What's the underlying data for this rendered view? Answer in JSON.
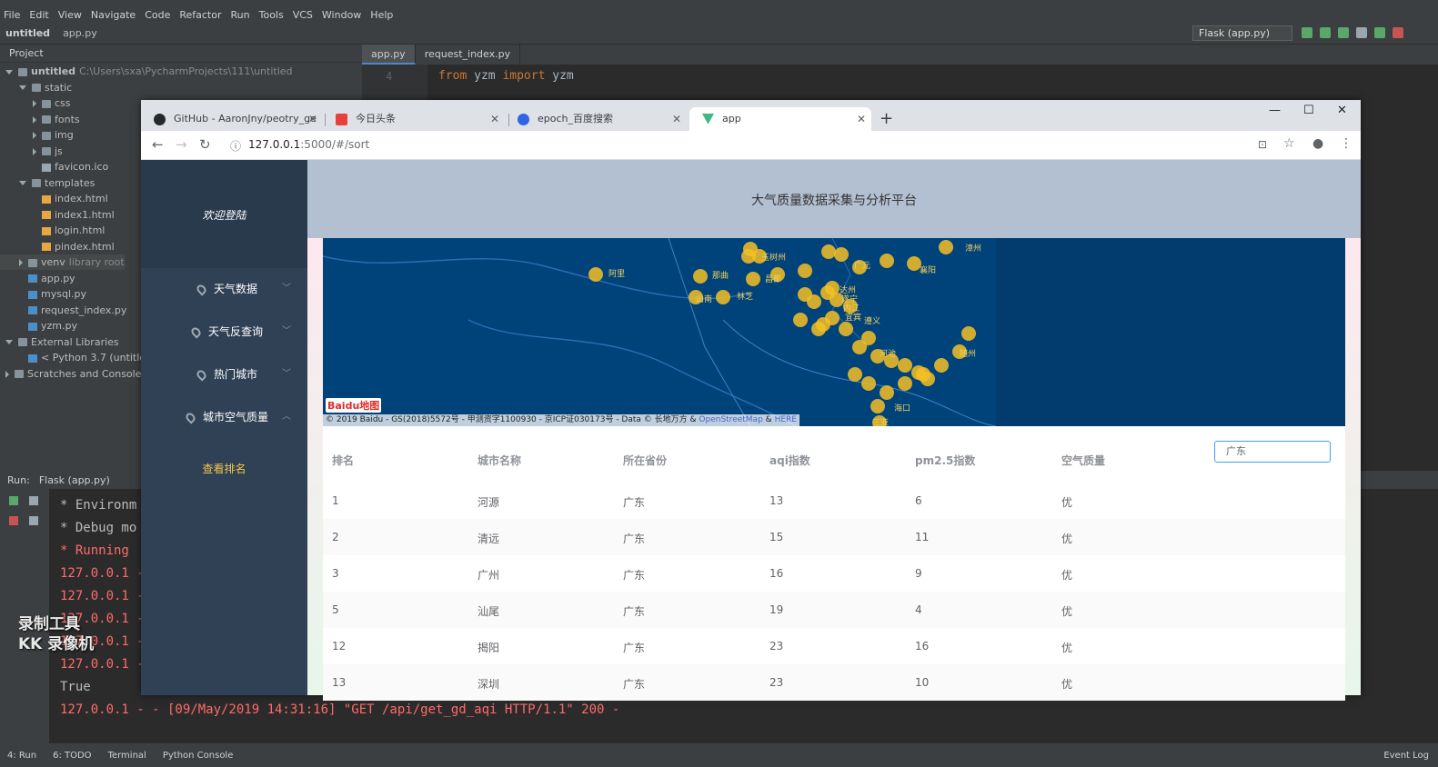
{
  "ide": {
    "menu": [
      "File",
      "Edit",
      "View",
      "Navigate",
      "Code",
      "Refactor",
      "Run",
      "Tools",
      "VCS",
      "Window",
      "Help"
    ],
    "breadcrumb": [
      "untitled",
      "app.py"
    ],
    "run_config": "Flask (app.py)",
    "project_header": "Project",
    "tree": [
      {
        "label": "untitled",
        "extra": "C:\\Users\\sxa\\PycharmProjects\\111\\untitled",
        "kind": "folder",
        "depth": 0,
        "open": true
      },
      {
        "label": "static",
        "kind": "folder",
        "depth": 1,
        "open": true
      },
      {
        "label": "css",
        "kind": "folder",
        "depth": 2,
        "open": false
      },
      {
        "label": "fonts",
        "kind": "folder",
        "depth": 2,
        "open": false
      },
      {
        "label": "img",
        "kind": "folder",
        "depth": 2,
        "open": false
      },
      {
        "label": "js",
        "kind": "folder",
        "depth": 2,
        "open": false
      },
      {
        "label": "favicon.ico",
        "kind": "ico",
        "depth": 2
      },
      {
        "label": "templates",
        "kind": "folder",
        "depth": 1,
        "open": true
      },
      {
        "label": "index.html",
        "kind": "html",
        "depth": 2
      },
      {
        "label": "index1.html",
        "kind": "html",
        "depth": 2
      },
      {
        "label": "login.html",
        "kind": "html",
        "depth": 2
      },
      {
        "label": "pindex.html",
        "kind": "html",
        "depth": 2
      },
      {
        "label": "venv",
        "extra": "library root",
        "kind": "folder",
        "depth": 1,
        "open": false
      },
      {
        "label": "app.py",
        "kind": "py",
        "depth": 1
      },
      {
        "label": "mysql.py",
        "kind": "py",
        "depth": 1
      },
      {
        "label": "request_index.py",
        "kind": "py",
        "depth": 1
      },
      {
        "label": "yzm.py",
        "kind": "py",
        "depth": 1
      },
      {
        "label": "External Libraries",
        "kind": "folder",
        "depth": 0,
        "open": true
      },
      {
        "label": "< Python 3.7 (untitled",
        "kind": "py",
        "depth": 1,
        "open": false
      },
      {
        "label": "Scratches and Consoles",
        "kind": "folder",
        "depth": 0,
        "open": false
      }
    ],
    "editor_tabs": [
      "app.py",
      "request_index.py"
    ],
    "code_lines": [
      {
        "num": "4",
        "kw1": "from",
        "t1": " yzm ",
        "kw2": "import",
        "t2": " yzm"
      }
    ],
    "run_header": [
      "Run:",
      "Flask (app.py)"
    ],
    "console": [
      {
        "text": " * Environm",
        "color": "gray"
      },
      {
        "text": " * Debug mo",
        "color": "gray"
      },
      {
        "text": " * Running",
        "color": "red"
      },
      {
        "text": "127.0.0.1 -",
        "color": "red"
      },
      {
        "text": "127.0.0.1 -",
        "color": "red"
      },
      {
        "text": "127.0.0.1 -",
        "color": "red"
      },
      {
        "text": "127.0.0.1 -",
        "color": "red"
      },
      {
        "text": "127.0.0.1 -",
        "color": "red"
      },
      {
        "text": "True",
        "color": "gray"
      },
      {
        "text": "127.0.0.1 - - [09/May/2019 14:31:16] \"GET /api/get_gd_aqi HTTP/1.1\" 200 -",
        "color": "red"
      }
    ],
    "status": [
      "4: Run",
      "6: TODO",
      "Terminal",
      "Python Console"
    ],
    "status_right": "Event Log",
    "watermark": [
      "录制工具",
      "KK 录像机"
    ]
  },
  "browser": {
    "tabs": [
      {
        "title": "GitHub - AaronJny/peotry_ge",
        "favicon_color": "#24292e"
      },
      {
        "title": "今日头条",
        "favicon_color": "#e8403d"
      },
      {
        "title": "epoch_百度搜索",
        "favicon_color": "#3064e8"
      },
      {
        "title": "app",
        "favicon_color": "#41b883"
      }
    ],
    "url_host": "127.0.0.1",
    "url_rest": ":5000/#/sort"
  },
  "app": {
    "welcome": "欢迎登陆",
    "title": "大气质量数据采集与分析平台",
    "menu": [
      "天气数据",
      "天气反查询",
      "热门城市",
      "城市空气质量"
    ],
    "submenu_active": "查看排名",
    "map_copyright": "© 2019 Baidu - GS(2018)5572号 - 甲测资字1100930 - 京ICP证030173号 - Data © 长地万方 &",
    "map_links": [
      "OpenStreetMap",
      "&",
      "HERE"
    ],
    "map_logo": "Baidu地图",
    "map_places": [
      "阿里",
      "那曲",
      "玉树州",
      "昌都",
      "林芝",
      "山南",
      "广元",
      "达州",
      "遂宁",
      "内江",
      "宜宾",
      "遵义",
      "河池",
      "海口",
      "三亚",
      "襄阳",
      "随州",
      "漳州"
    ],
    "search_value": "广东",
    "table": {
      "headers": [
        "排名",
        "城市名称",
        "所在省份",
        "aqi指数",
        "pm2.5指数",
        "空气质量"
      ],
      "rows": [
        [
          "1",
          "河源",
          "广东",
          "13",
          "6",
          "优"
        ],
        [
          "2",
          "清远",
          "广东",
          "15",
          "11",
          "优"
        ],
        [
          "3",
          "广州",
          "广东",
          "16",
          "9",
          "优"
        ],
        [
          "5",
          "汕尾",
          "广东",
          "19",
          "4",
          "优"
        ],
        [
          "12",
          "揭阳",
          "广东",
          "23",
          "16",
          "优"
        ],
        [
          "13",
          "深圳",
          "广东",
          "23",
          "10",
          "优"
        ]
      ]
    }
  },
  "colors": {
    "sidebar": "#304156",
    "header": "#b3c0d1",
    "map": "#00427a",
    "dot": "#f5c023",
    "active_sub": "#f5c74a"
  }
}
